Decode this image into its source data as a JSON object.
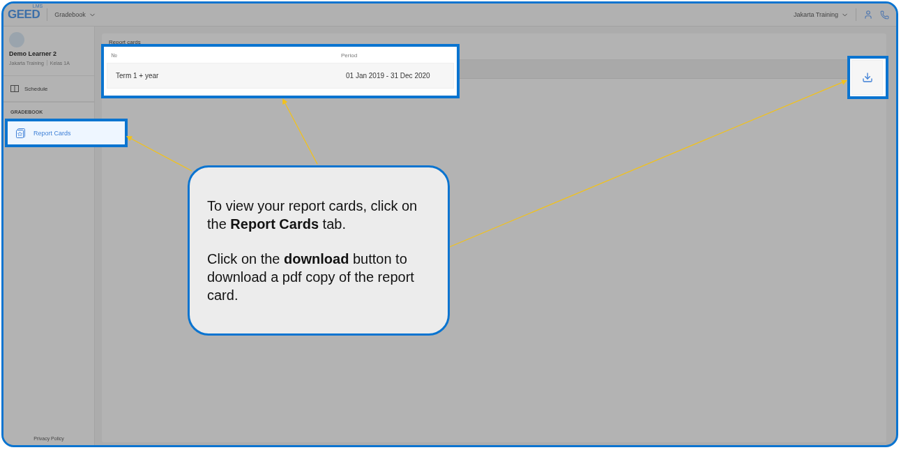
{
  "header": {
    "logo": "GEED",
    "logo_badge": "LMS",
    "section": "Gradebook",
    "organization": "Jakarta Training"
  },
  "sidebar": {
    "user": {
      "name": "Demo Learner 2",
      "organization": "Jakarta Training",
      "class": "Kelas 1A"
    },
    "items": [
      {
        "label": "Schedule",
        "kind": "schedule",
        "selected": false
      }
    ],
    "group_title": "GRADEBOOK",
    "group_items": [
      {
        "label": "Report Cards",
        "kind": "report",
        "selected": true
      }
    ],
    "footer": "Privacy Policy"
  },
  "main": {
    "title": "Report cards",
    "table": {
      "columns": [
        "№",
        "Period"
      ],
      "rows": [
        [
          "Term 1 + year",
          "01 Jan 2019 - 31 Dec 2020"
        ]
      ]
    }
  },
  "callout": {
    "paragraphs": [
      "To view your report cards, click on the **Report Cards** tab.",
      "Click on the **download** button to download a pdf copy of the report card."
    ]
  }
}
